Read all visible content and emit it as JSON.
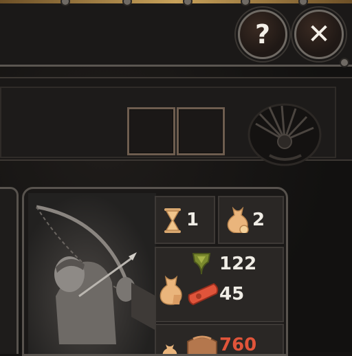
{
  "window": {
    "help_icon": "question-mark",
    "close_icon": "x-mark",
    "help_glyph": "?",
    "close_glyph": "✕"
  },
  "unit_card": {
    "portrait": "archer-with-longbow",
    "stats": {
      "turns": {
        "icon": "hourglass-icon",
        "value": "1"
      },
      "upkeep": {
        "icon": "coin-sack-icon",
        "value": "2"
      },
      "cost_green": {
        "icon": "green-emblem-icon",
        "value": "122"
      },
      "cost_red": {
        "icon": "red-scroll-icon",
        "value": "45"
      },
      "wealth": {
        "icon": "treasure-chest-icon",
        "value": "760"
      }
    }
  },
  "colors": {
    "accent_gold": "#c9a25a",
    "value_red": "#e0543a",
    "panel_border": "#58534e"
  }
}
